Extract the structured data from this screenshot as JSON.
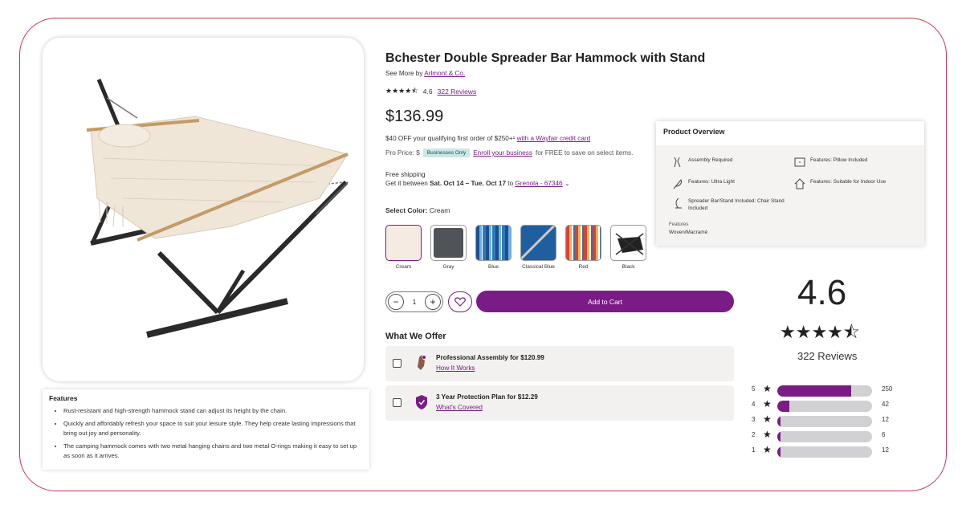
{
  "product": {
    "title": "Bchester Double Spreader Bar Hammock with Stand",
    "see_more_prefix": "See More by ",
    "brand": "Arlmont & Co.",
    "stars": "★★★★⯪",
    "rating": "4.6",
    "reviews_link": "322 Reviews",
    "price": "$136.99",
    "promo_text": "$40 OFF your qualifying first order of $250+¹ ",
    "promo_link": "with a Wayfair credit card",
    "pro_price_label": "Pro Price: $",
    "pro_badge": "Businesses Only",
    "pro_link": "Enroll your business",
    "pro_suffix": "for FREE to save on select items.",
    "free_shipping": "Free shipping",
    "delivery_prefix": "Get it between ",
    "delivery_dates": "Sat. Oct 14 – Tue. Oct 17",
    "delivery_to": " to ",
    "delivery_location": "Grenola - 67346",
    "chevron": "⌄",
    "select_color_label": "Select Color:",
    "selected_color": "Cream"
  },
  "swatches": [
    {
      "label": "Cream",
      "color": "#f6ebe3"
    },
    {
      "label": "Gray",
      "color": "#505459"
    },
    {
      "label": "Blue",
      "color": "#2f7ab8"
    },
    {
      "label": "Classical Blue",
      "color": "#1f5fa0"
    },
    {
      "label": "Red",
      "color": "#d7433a"
    },
    {
      "label": "Black",
      "color": "#ffffff"
    }
  ],
  "overview": {
    "title": "Product Overview",
    "items": [
      {
        "icon": "wrench-icon",
        "text": "Assembly Required"
      },
      {
        "icon": "pillow-icon",
        "text": "Features: Pillow Included"
      },
      {
        "icon": "feather-icon",
        "text": "Features: Ultra Light"
      },
      {
        "icon": "house-icon",
        "text": "Features: Suitable for Indoor Use"
      },
      {
        "icon": "stand-icon",
        "text": "Spreader Bar/Stand Included: Chair Stand Included"
      }
    ],
    "features_label": "Features",
    "features_value": "Woven/Macramé"
  },
  "cart": {
    "minus": "−",
    "quantity": "1",
    "plus": "+",
    "add_to_cart": "Add to Cart"
  },
  "offers": {
    "title": "What We Offer",
    "items": [
      {
        "text": "Professional Assembly for $120.99",
        "link": "How It Works"
      },
      {
        "text": "3 Year Protection Plan for $12.29",
        "link": "What's Covered"
      }
    ]
  },
  "features_panel": {
    "title": "Features",
    "items": [
      "Rust-resistant and high-strength hammock stand can adjust its height by the chain.",
      "Quickly and affordably refresh your space to suit your leisure style. They help create lasting impressions that bring out joy and personality.",
      "The camping hammock comes with two metal hanging chains and two metal O-rings making it easy to set up as soon as it arrives."
    ]
  },
  "rating_summary": {
    "average": "4.6",
    "stars": "★★★★⯪",
    "count_label": "322 Reviews",
    "distribution": [
      {
        "stars": "5",
        "count": 250,
        "fraction": 0.78
      },
      {
        "stars": "4",
        "count": 42,
        "fraction": 0.13
      },
      {
        "stars": "3",
        "count": 12,
        "fraction": 0.02
      },
      {
        "stars": "2",
        "count": 6,
        "fraction": 0.01
      },
      {
        "stars": "1",
        "count": 12,
        "fraction": 0.02
      }
    ]
  },
  "colors": {
    "accent": "#7b1b86",
    "frame_border": "#c8324f"
  }
}
